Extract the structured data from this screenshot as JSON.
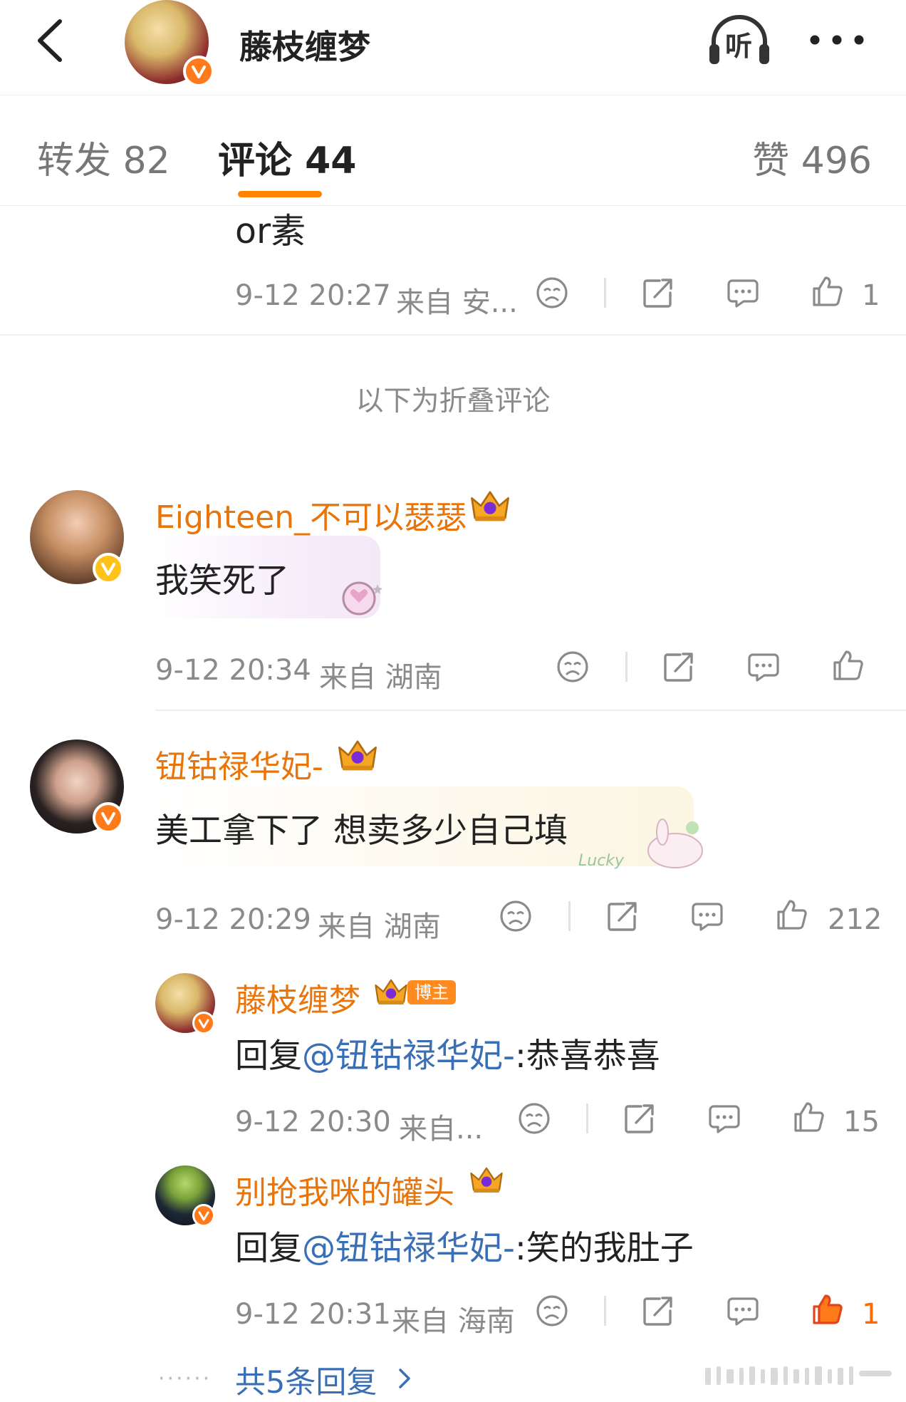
{
  "header": {
    "title": "藤枝缠梦",
    "listen_label": "听"
  },
  "tabs": [
    {
      "label": "转发 82"
    },
    {
      "label": "评论 44"
    },
    {
      "label": "赞 496"
    }
  ],
  "colors": {
    "accent": "#ff8200",
    "username": "#e8740a",
    "link": "#3a6fb5",
    "meta": "#8a8a8a",
    "liked": "#ff6a00",
    "verified_gold": "#ffc21a",
    "verified_orange": "#ff7a1a"
  },
  "top_comment": {
    "text_tail": "or素",
    "time": "9-12 20:27",
    "source": "来自 安...",
    "likes": "1"
  },
  "fold_label": "以下为折叠评论",
  "comments": [
    {
      "username": "Eighteen_不可以瑟瑟",
      "text": "我笑死了",
      "time": "9-12 20:34",
      "source": "来自 湖南",
      "likes": ""
    },
    {
      "username": "钮钴禄华妃-",
      "text": "美工拿下了 想卖多少自己填",
      "time": "9-12 20:29",
      "source": "来自 湖南",
      "likes": "212",
      "bubble_tag": "Lucky",
      "replies": [
        {
          "username": "藤枝缠梦",
          "badge": "博主",
          "reply_prefix": "回复",
          "mention": "@钮钴禄华妃-",
          "reply_text": ":恭喜恭喜",
          "time": "9-12 20:30",
          "source": "来自...",
          "likes": "15"
        },
        {
          "username": "别抢我咪的罐头",
          "reply_prefix": "回复",
          "mention": "@钮钴禄华妃-",
          "reply_text": ":笑的我肚子",
          "time": "9-12 20:31",
          "source": "来自 海南",
          "likes": "1",
          "liked": true
        }
      ],
      "more_replies": "共5条回复"
    }
  ],
  "icons": [
    "back-arrow-icon",
    "listen-headphones-icon",
    "more-dots-icon",
    "dislike-face-icon",
    "share-icon",
    "comment-icon",
    "like-thumb-icon",
    "crown-icon",
    "verified-v-icon",
    "chevron-right-icon"
  ]
}
